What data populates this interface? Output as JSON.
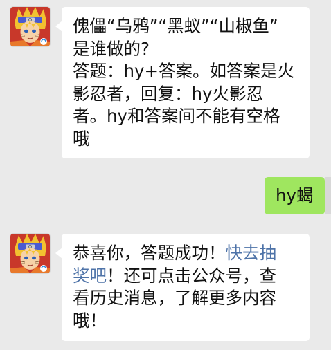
{
  "colors": {
    "background": "#eaeaea",
    "incoming_bubble": "#ffffff",
    "outgoing_bubble": "#9fe65f",
    "link": "#4e73a8"
  },
  "messages": [
    {
      "direction": "incoming",
      "sender_avatar": "naruto-game-account-avatar",
      "lines": [
        "傀儡“乌鸦”“黑蚁”“山椒鱼”",
        "是谁做的?",
        "答题：hy+答案。如答案是火",
        "影忍者，回复：hy火影忍",
        "者。hy和答案间不能有空格",
        "哦"
      ]
    },
    {
      "direction": "outgoing",
      "text": "hy蝎"
    },
    {
      "direction": "incoming",
      "sender_avatar": "naruto-game-account-avatar",
      "line1_text": "恭喜你，答题成功！",
      "link_part1": "快去抽",
      "link_part2": "奖吧",
      "line2_rest": "！还可点击公众号，查",
      "line3": "看历史消息，了解更多内容",
      "line4": "哦！"
    }
  ]
}
